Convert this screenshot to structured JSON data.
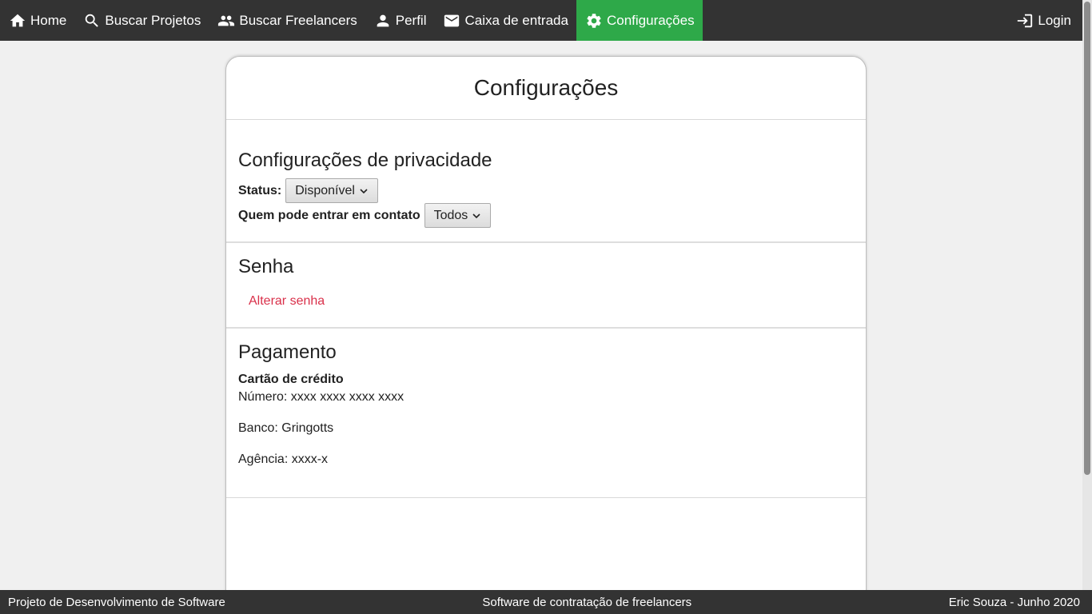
{
  "nav": {
    "items": [
      {
        "label": "Home",
        "icon": "home-icon"
      },
      {
        "label": "Buscar Projetos",
        "icon": "search-icon"
      },
      {
        "label": "Buscar Freelancers",
        "icon": "people-icon"
      },
      {
        "label": "Perfil",
        "icon": "person-icon"
      },
      {
        "label": "Caixa de entrada",
        "icon": "mail-icon"
      },
      {
        "label": "Configurações",
        "icon": "gear-icon",
        "active": true
      }
    ],
    "login": {
      "label": "Login",
      "icon": "login-icon"
    },
    "active_color": "#2ea949",
    "background": "#333333"
  },
  "page": {
    "title": "Configurações",
    "privacy": {
      "heading": "Configurações de privacidade",
      "status_label": "Status:",
      "status_value": "Disponível",
      "contact_label": "Quem pode entrar em contato",
      "contact_value": "Todos"
    },
    "password": {
      "heading": "Senha",
      "change_link": "Alterar senha",
      "link_color": "#d9304a"
    },
    "payment": {
      "heading": "Pagamento",
      "subheading": "Cartão de crédito",
      "number": "Número: xxxx xxxx xxxx xxxx",
      "bank": "Banco: Gringotts",
      "agency": "Agência: xxxx-x"
    }
  },
  "footer": {
    "left": "Projeto de Desenvolvimento de Software",
    "center": "Software de contratação de freelancers",
    "right": "Eric Souza - Junho 2020"
  }
}
